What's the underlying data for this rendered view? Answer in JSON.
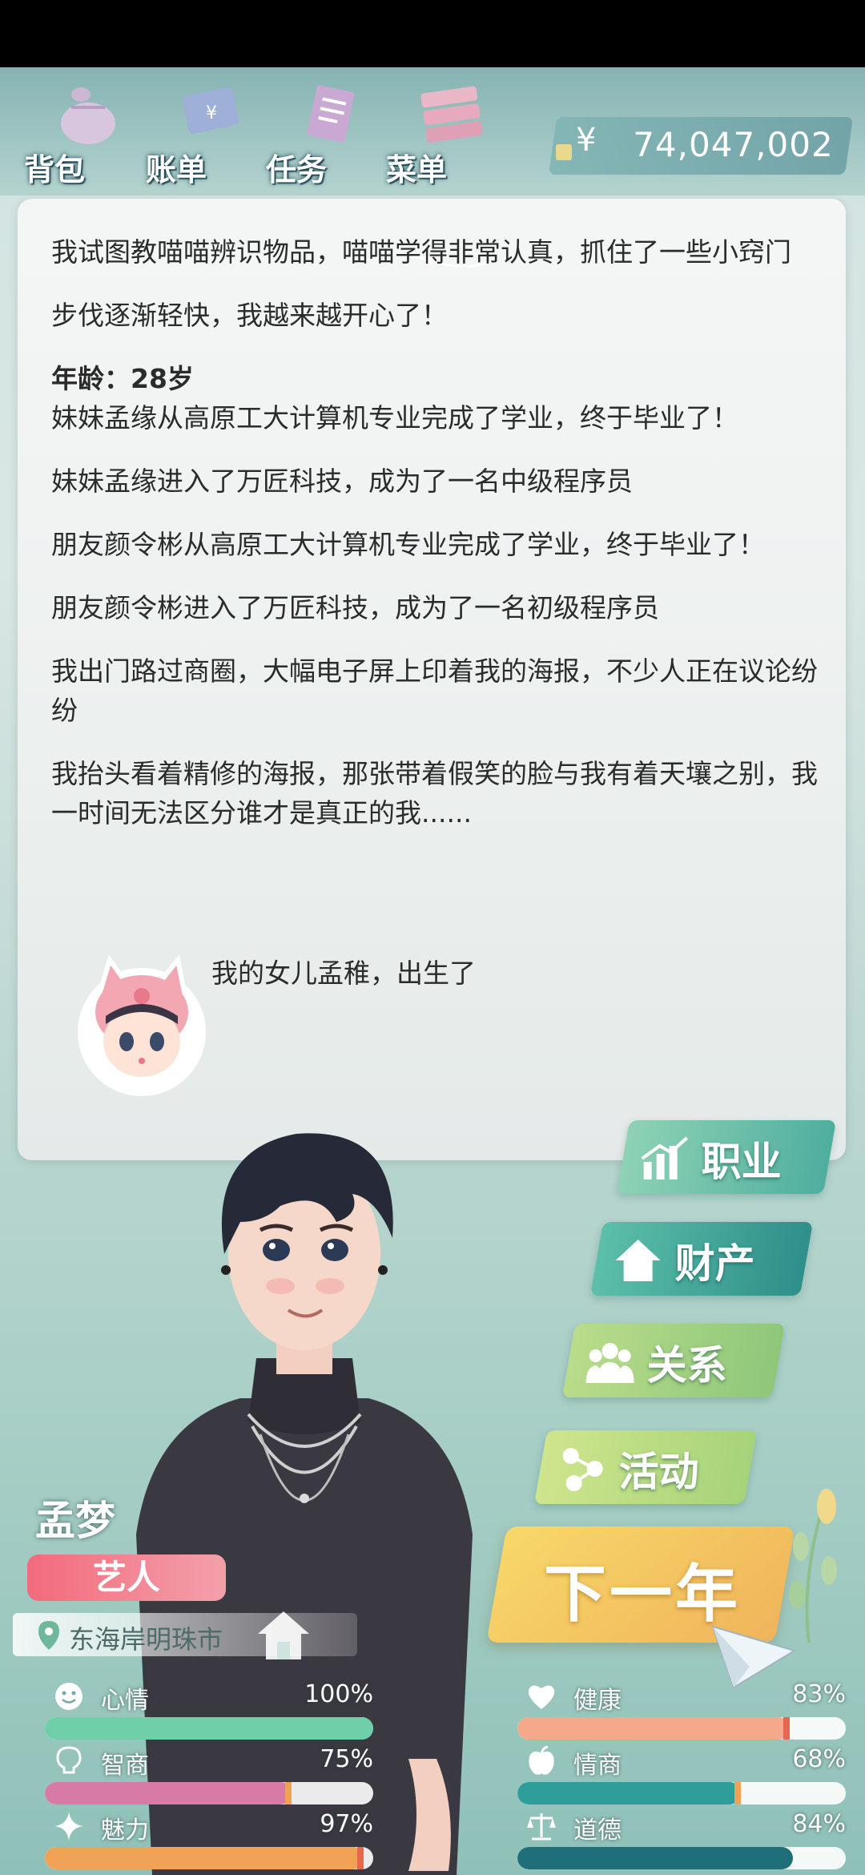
{
  "topbar": {
    "buttons": [
      {
        "label": "背包",
        "icon": "bag-icon"
      },
      {
        "label": "账单",
        "icon": "bill-icon"
      },
      {
        "label": "任务",
        "icon": "task-icon"
      },
      {
        "label": "菜单",
        "icon": "menu-icon"
      }
    ],
    "currency_symbol": "¥",
    "money": "74,047,002"
  },
  "log": {
    "entries": [
      "我试图教喵喵辨识物品，喵喵学得非常认真，抓住了一些小窍门",
      "步伐逐渐轻快，我越来越开心了！",
      "年龄：28岁",
      "妹妹孟缘从高原工大计算机专业完成了学业，终于毕业了！",
      "妹妹孟缘进入了万匠科技，成为了一名中级程序员",
      "朋友颜令彬从高原工大计算机专业完成了学业，终于毕业了！",
      "朋友颜令彬进入了万匠科技，成为了一名初级程序员",
      "我出门路过商圈，大幅电子屏上印着我的海报，不少人正在议论纷纷",
      "我抬头看着精修的海报，那张带着假笑的脸与我有着天壤之别，我一时间无法区分谁才是真正的我......"
    ],
    "baby_event": "我的女儿孟稚，出生了"
  },
  "menu": {
    "career": "职业",
    "assets": "财产",
    "relations": "关系",
    "activities": "活动",
    "next_year": "下一年"
  },
  "character": {
    "name": "孟梦",
    "job": "艺人",
    "location": "东海岸明珠市"
  },
  "stats": [
    {
      "label": "心情",
      "value_text": "100%",
      "value": 100,
      "icon": "smile-icon",
      "color": "#6fcfa8"
    },
    {
      "label": "健康",
      "value_text": "83%",
      "value": 83,
      "icon": "heart-icon",
      "color": "#f6a98a"
    },
    {
      "label": "智商",
      "value_text": "75%",
      "value": 75,
      "icon": "bulb-icon",
      "color": "#d87aa6"
    },
    {
      "label": "情商",
      "value_text": "68%",
      "value": 68,
      "icon": "apple-icon",
      "color": "#2f9d9a"
    },
    {
      "label": "魅力",
      "value_text": "97%",
      "value": 97,
      "icon": "sparkle-icon",
      "color": "#f0a256"
    },
    {
      "label": "道德",
      "value_text": "84%",
      "value": 84,
      "icon": "scale-icon",
      "color": "#1e6f7a"
    }
  ]
}
